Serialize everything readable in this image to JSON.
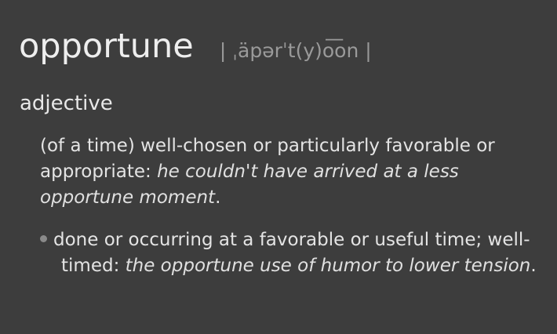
{
  "entry": {
    "headword": "opportune",
    "pronunciation": "| ˌäpərˈt(y)o͞on |",
    "part_of_speech": "adjective",
    "sense1": {
      "definition": "(of a time) well-chosen or particularly favorable or appropriate: ",
      "example": "he couldn't have arrived at a less opportune moment",
      "end": "."
    },
    "sense2": {
      "definition": "done or occurring at a favorable or useful time; well-timed: ",
      "example": "the opportune use of humor to lower tension",
      "end": "."
    }
  },
  "colors": {
    "background": "#3d3d3d",
    "text": "#e6e6e6",
    "pronunciation": "#9a9a9a",
    "bullet": "#8a8a8a"
  },
  "icons": {
    "subsense_bullet": "bullet-dot-icon"
  }
}
